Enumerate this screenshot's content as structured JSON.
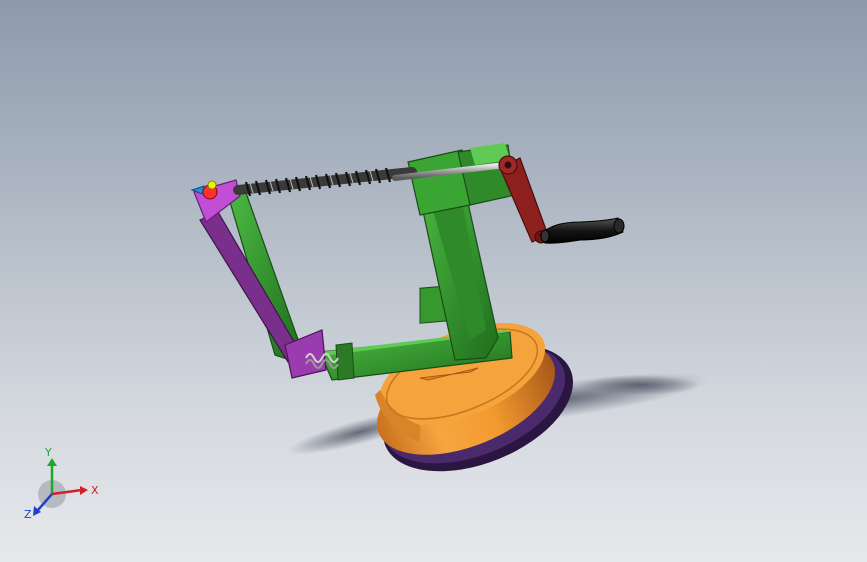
{
  "scene": {
    "model": "apple-peeler-assembly",
    "colors": {
      "frame": "#2f8a2a",
      "frame_dark": "#1f5e1c",
      "frame_light": "#4cbb43",
      "arm": "#7b2f8c",
      "arm_light": "#c04fd6",
      "crank": "#8e1f1f",
      "handle": "#1b1b1b",
      "base": "#f29a2e",
      "base_dark": "#b8661a",
      "suction": "#3a1e55",
      "spring": "#b9b9b9",
      "screw": "#2d2d2d"
    }
  },
  "triad": {
    "x_label": "X",
    "y_label": "Y",
    "z_label": "Z",
    "x_color": "#d0202a",
    "y_color": "#1ea82b",
    "z_color": "#2040c8"
  }
}
